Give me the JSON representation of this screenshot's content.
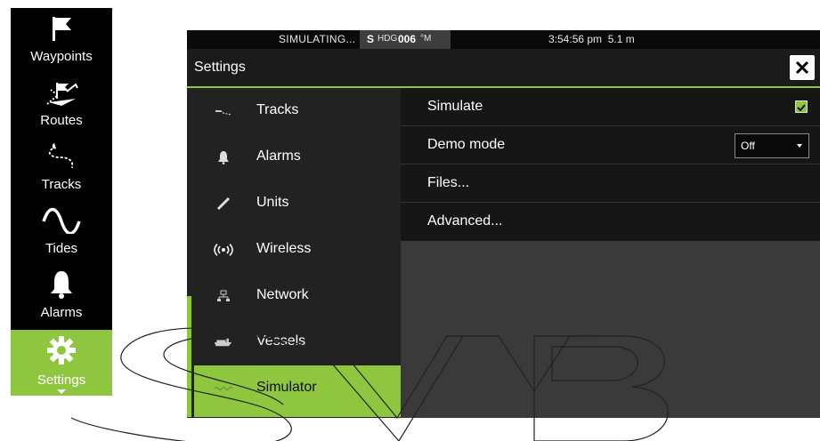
{
  "sidebar": {
    "items": [
      {
        "label": "Waypoints",
        "icon": "flag-icon"
      },
      {
        "label": "Routes",
        "icon": "route-icon"
      },
      {
        "label": "Tracks",
        "icon": "tracks-icon"
      },
      {
        "label": "Tides",
        "icon": "wave-icon"
      },
      {
        "label": "Alarms",
        "icon": "bell-icon"
      },
      {
        "label": "Settings",
        "icon": "gear-icon"
      }
    ]
  },
  "statusbar": {
    "simulating": "SIMULATING...",
    "hdg_s": "S",
    "hdg_label": "HDG",
    "hdg_value": "006",
    "hdg_unit": "°M",
    "time": "3:54:56 pm",
    "depth": "5.1 m"
  },
  "title": "Settings",
  "categories": [
    {
      "label": "Tracks",
      "icon": "boat-track-icon"
    },
    {
      "label": "Alarms",
      "icon": "bell-icon"
    },
    {
      "label": "Units",
      "icon": "ruler-icon"
    },
    {
      "label": "Wireless",
      "icon": "wireless-icon"
    },
    {
      "label": "Network",
      "icon": "network-icon"
    },
    {
      "label": "Vessels",
      "icon": "vessels-icon"
    },
    {
      "label": "Simulator",
      "icon": "simulator-icon"
    }
  ],
  "options": {
    "simulate": {
      "label": "Simulate",
      "checked": true
    },
    "demo_mode": {
      "label": "Demo mode",
      "value": "Off"
    },
    "files": {
      "label": "Files..."
    },
    "advanced": {
      "label": "Advanced..."
    }
  },
  "colors": {
    "accent": "#8ec63f",
    "panel": "#3a3a3a",
    "sidebar": "#000000"
  },
  "watermark": "SVB"
}
